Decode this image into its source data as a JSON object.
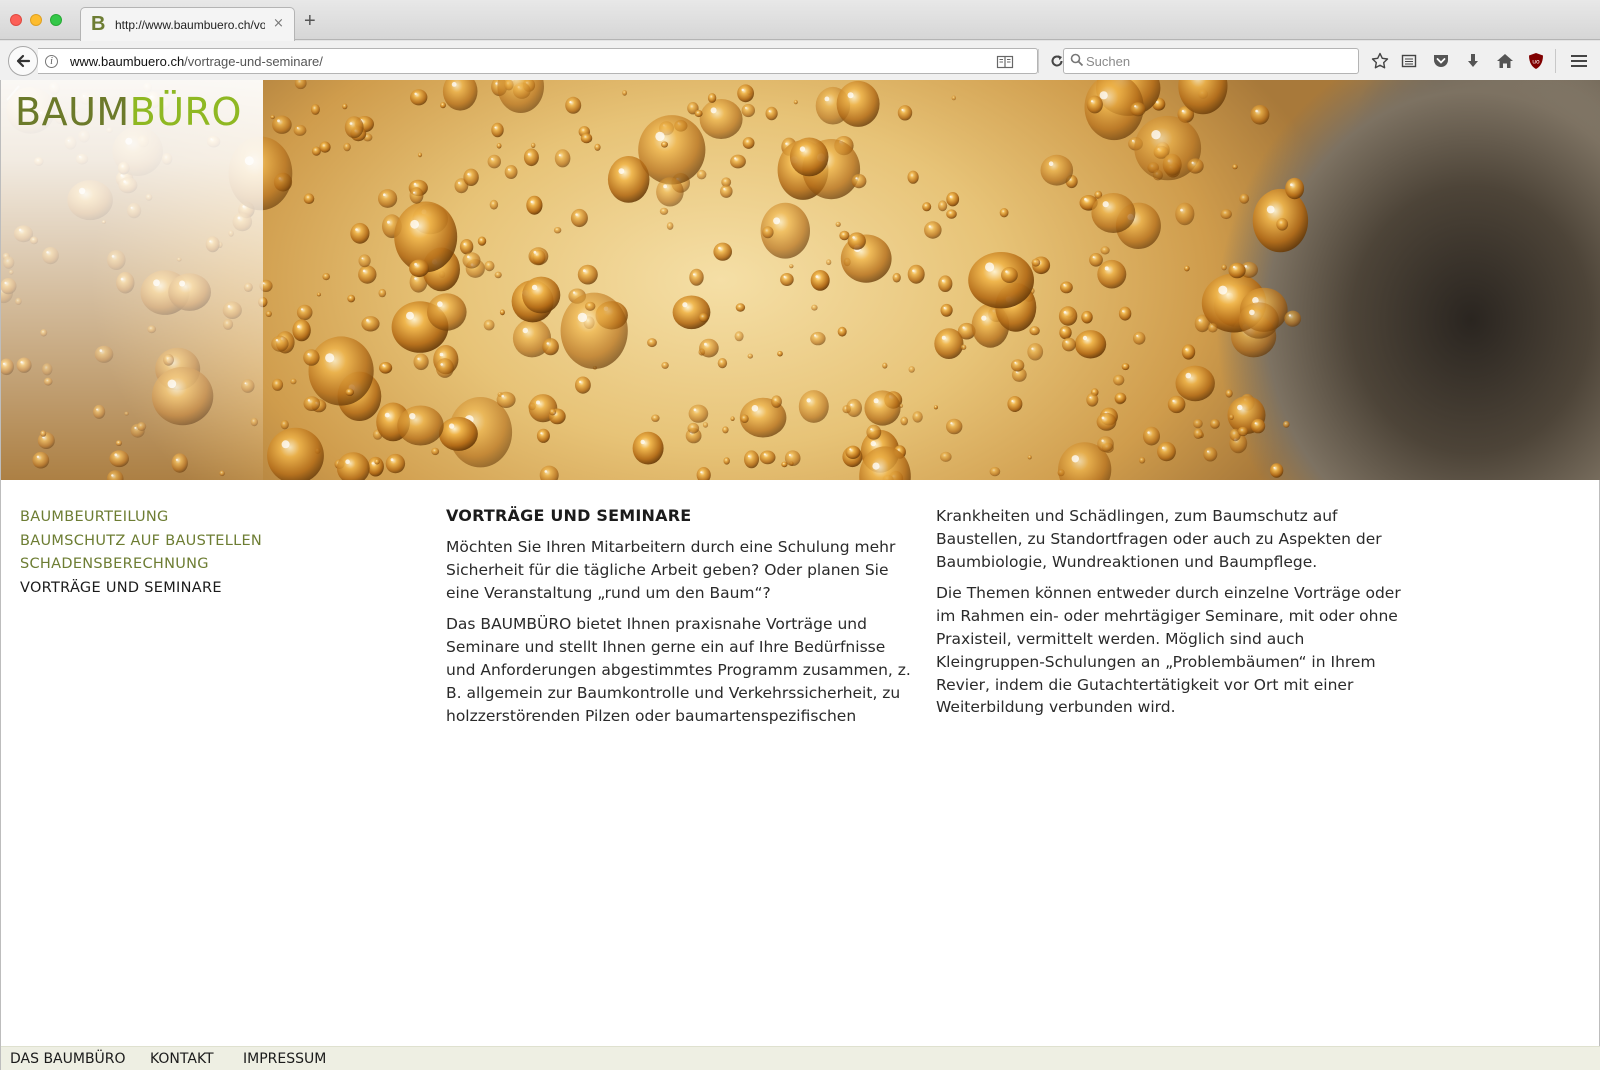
{
  "browser": {
    "tab_title": "http://www.baumbuero.ch/vortrage-und-seminare/",
    "tab_favicon": "B",
    "new_tab_label": "+",
    "close_tab_label": "×",
    "url_host": "www.baumbuero.ch",
    "url_path": "/vortrage-und-seminare/",
    "search_placeholder": "Suchen",
    "toolbar_icons": [
      "bookmark-star-icon",
      "reading-list-icon",
      "pocket-icon",
      "downloads-icon",
      "home-icon",
      "ublock-icon",
      "menu-icon"
    ]
  },
  "site": {
    "logo_part1": "BAUM",
    "logo_part2": "BÜRO",
    "brand_color": "#6c7a2a",
    "accent_color": "#8fb822"
  },
  "sidenav": {
    "items": [
      {
        "label": "BAUMBEURTEILUNG",
        "active": false
      },
      {
        "label": "BAUMSCHUTZ AUF BAUSTELLEN",
        "active": false
      },
      {
        "label": "SCHADENSBERECHNUNG",
        "active": false
      },
      {
        "label": "VORTRÄGE UND SEMINARE",
        "active": true
      }
    ]
  },
  "content": {
    "heading": "VORTRÄGE UND SEMINARE",
    "col1_p1": "Möchten Sie Ihren Mitarbeitern durch eine Schulung mehr Sicherheit für die tägliche Arbeit geben? Oder planen Sie eine Veranstaltung „rund um den Baum“?",
    "col1_p2": "Das BAUMBÜRO bietet Ihnen praxisnahe Vorträge und Seminare und stellt Ihnen gerne ein auf Ihre Bedürfnisse und Anforderungen abgestimmtes Programm zusammen, z. B. allgemein zur Baumkontrolle und Verkehrssicherheit, zu holzzerstörenden Pilzen oder baumartenspezifischen",
    "col2_p1": "Krankheiten und Schädlingen, zum Baumschutz auf Baustellen, zu Standortfragen oder auch zu Aspekten der Baumbiologie, Wundreaktionen und Baumpflege.",
    "col2_p2": "Die Themen können entweder durch einzelne Vorträge oder im Rahmen ein- oder mehrtägiger Seminare, mit oder ohne Praxisteil, vermittelt werden. Möglich sind auch Kleingruppen-Schulungen an „Problembäumen“ in Ihrem Revier, indem die Gutachtertätigkeit vor Ort mit einer Weiterbildung verbunden wird."
  },
  "footer": {
    "links": [
      "DAS BAUMBÜRO",
      "KONTAKT",
      "IMPRESSUM"
    ],
    "background": "#eeefe3"
  }
}
